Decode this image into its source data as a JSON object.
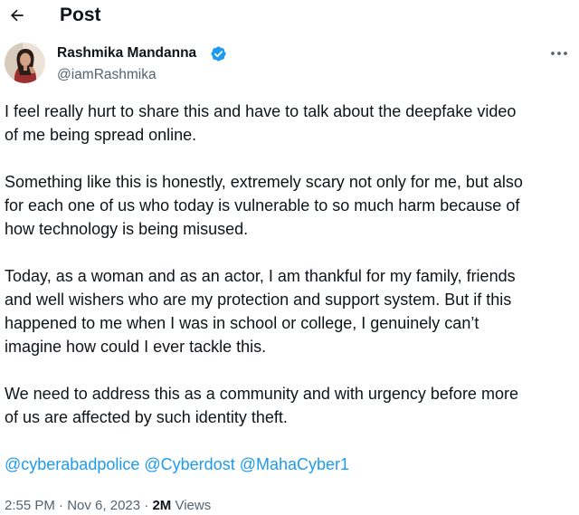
{
  "header": {
    "title": "Post"
  },
  "author": {
    "name": "Rashmika Mandanna",
    "handle": "@iamRashmika",
    "verified": true
  },
  "tweet": {
    "paragraphs": [
      "I feel really hurt to share this and have to talk about the deepfake video\nof me being spread online.",
      "Something like this is honestly, extremely scary not only for me, but also\nfor each one of us who today is vulnerable to so much harm because of\nhow technology is being misused.",
      "Today, as a woman and as an actor, I am thankful for my family, friends\nand well wishers who are my protection and support system. But if this\nhappened to me when I was in school or college, I genuinely can’t\nimagine how could I ever tackle this.",
      "We need to address this as a community and with urgency before more\nof us are affected by such identity theft."
    ],
    "mentions": [
      "@cyberabadpolice",
      "@Cyberdost",
      "@MahaCyber1"
    ]
  },
  "meta": {
    "time": "2:55 PM",
    "separator": "·",
    "date": "Nov 6, 2023",
    "views_count": "2M",
    "views_label": "Views"
  },
  "colors": {
    "text": "#0f1419",
    "secondary": "#536471",
    "link": "#1d9bf0",
    "verified_badge": "#1d9bf0"
  },
  "icons": {
    "back": "arrow-left-icon",
    "verified": "verified-badge-icon",
    "more": "more-horizontal-icon"
  }
}
